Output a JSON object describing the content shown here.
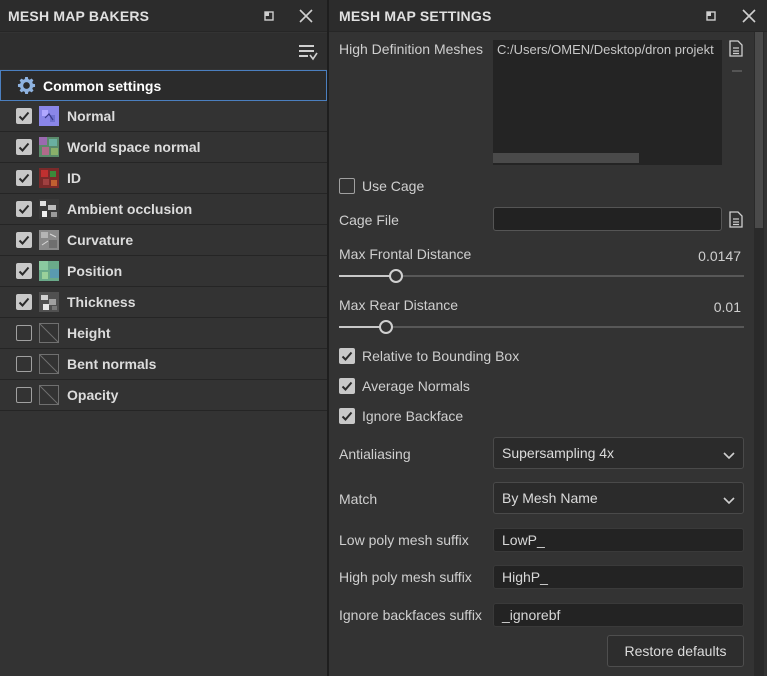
{
  "left_panel": {
    "title": "MESH MAP BAKERS",
    "common_settings": "Common settings",
    "items": [
      {
        "label": "Normal",
        "checked": true,
        "icon": "normal-map-thumb"
      },
      {
        "label": "World space normal",
        "checked": true,
        "icon": "world-normal-thumb"
      },
      {
        "label": "ID",
        "checked": true,
        "icon": "id-map-thumb"
      },
      {
        "label": "Ambient occlusion",
        "checked": true,
        "icon": "ao-map-thumb"
      },
      {
        "label": "Curvature",
        "checked": true,
        "icon": "curvature-map-thumb"
      },
      {
        "label": "Position",
        "checked": true,
        "icon": "position-map-thumb"
      },
      {
        "label": "Thickness",
        "checked": true,
        "icon": "thickness-map-thumb"
      },
      {
        "label": "Height",
        "checked": false,
        "icon": "empty-map-thumb"
      },
      {
        "label": "Bent normals",
        "checked": false,
        "icon": "empty-map-thumb"
      },
      {
        "label": "Opacity",
        "checked": false,
        "icon": "empty-map-thumb"
      }
    ]
  },
  "right_panel": {
    "title": "MESH MAP SETTINGS",
    "high_def_meshes_label": "High Definition Meshes",
    "high_def_meshes_path": "C:/Users/OMEN/Desktop/dron projekt",
    "use_cage_label": "Use Cage",
    "use_cage_checked": false,
    "cage_file_label": "Cage File",
    "cage_file_value": "",
    "max_frontal_label": "Max Frontal Distance",
    "max_frontal_value": "0.0147",
    "max_frontal_fraction": 0.14,
    "max_rear_label": "Max Rear Distance",
    "max_rear_value": "0.01",
    "max_rear_fraction": 0.115,
    "relative_bbox_label": "Relative to Bounding Box",
    "relative_bbox_checked": true,
    "average_normals_label": "Average Normals",
    "average_normals_checked": true,
    "ignore_backface_label": "Ignore Backface",
    "ignore_backface_checked": true,
    "antialiasing_label": "Antialiasing",
    "antialiasing_value": "Supersampling 4x",
    "match_label": "Match",
    "match_value": "By Mesh Name",
    "low_suffix_label": "Low poly mesh suffix",
    "low_suffix_value": "LowP_",
    "high_suffix_label": "High poly mesh suffix",
    "high_suffix_value": "HighP_",
    "ignore_bf_suffix_label": "Ignore backfaces suffix",
    "ignore_bf_suffix_value": "_ignorebf",
    "restore_label": "Restore defaults"
  },
  "colors": {
    "accent_selected_border": "#4b7fbf",
    "panel_bg": "#333333",
    "text": "#d2d2d2"
  }
}
